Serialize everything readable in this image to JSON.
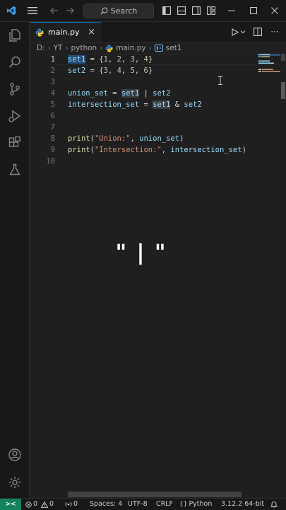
{
  "titlebar": {
    "search_placeholder": "Search"
  },
  "icons": {
    "vscode": "vscode-logo",
    "menu": "hamburger",
    "back": "arrow-left",
    "forward": "arrow-right",
    "search": "magnifier"
  },
  "tab": {
    "label": "main.py",
    "close": "×"
  },
  "breadcrumb": {
    "drive": "D:",
    "folder1": "YT",
    "folder2": "python",
    "file": "main.py",
    "symbol": "set1"
  },
  "editor": {
    "line_numbers": [
      "1",
      "2",
      "3",
      "4",
      "5",
      "6",
      "7",
      "8",
      "9",
      "10"
    ],
    "cursor_line": 1
  },
  "code": {
    "l1": {
      "var": "set1",
      "eq": " = {",
      "n1": "1",
      "c1": ", ",
      "n2": "2",
      "c2": ", ",
      "n3": "3",
      "c3": ", ",
      "n4": "4",
      "end": "}"
    },
    "l2": {
      "var": "set2",
      "eq": " = {",
      "n1": "3",
      "c1": ", ",
      "n2": "4",
      "c2": ", ",
      "n3": "5",
      "c3": ", ",
      "n4": "6",
      "end": "}"
    },
    "l4": {
      "var": "union_set",
      "eq": " = ",
      "a": "set1",
      "op": " | ",
      "b": "set2"
    },
    "l5": {
      "var": "intersection_set",
      "eq": " = ",
      "a": "set1",
      "op": " & ",
      "b": "set2"
    },
    "l8": {
      "fn": "print",
      "open": "(",
      "str": "\"Union:\"",
      "comma": ", ",
      "arg": "union_set",
      "close": ")"
    },
    "l9": {
      "fn": "print",
      "open": "(",
      "str": "\"Intersection:\"",
      "comma": ", ",
      "arg": "intersection_set",
      "close": ")"
    }
  },
  "overlay": {
    "text": "\" | \""
  },
  "statusbar": {
    "remote": "><",
    "errors": "0",
    "warnings": "0",
    "ports": "0",
    "spaces": "Spaces: 4",
    "encoding": "UTF-8",
    "eol": "CRLF",
    "language": "Python",
    "interpreter": "3.12.2 64-bit"
  },
  "colors": {
    "accent": "#0078d4",
    "remote": "#16825d",
    "editor_bg": "#1f1f1f"
  }
}
